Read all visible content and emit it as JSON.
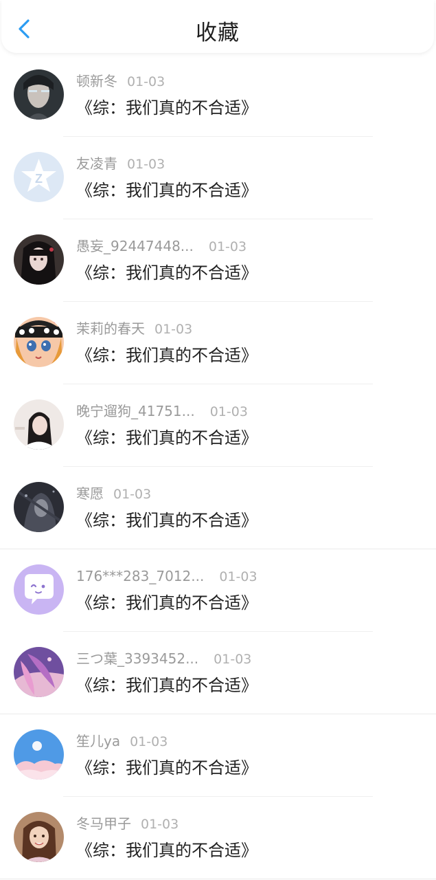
{
  "header": {
    "title": "收藏",
    "back_icon": "chevron-left-icon",
    "accent": "#2b9cf2"
  },
  "items": [
    {
      "name": "顿新冬",
      "date": "01-03",
      "title": "《综：我们真的不合适》"
    },
    {
      "name": "友凌青",
      "date": "01-03",
      "title": "《综：我们真的不合适》"
    },
    {
      "name": "愚妄_92447448...",
      "date": "01-03",
      "title": "《综：我们真的不合适》"
    },
    {
      "name": "茉莉的春天",
      "date": "01-03",
      "title": "《综：我们真的不合适》"
    },
    {
      "name": "晚宁遛狗_41751...",
      "date": "01-03",
      "title": "《综：我们真的不合适》"
    },
    {
      "name": "寒愿",
      "date": "01-03",
      "title": "《综：我们真的不合适》"
    },
    {
      "name": "176***283_7012...",
      "date": "01-03",
      "title": "《综：我们真的不合适》"
    },
    {
      "name": "三つ葉_3393452...",
      "date": "01-03",
      "title": "《综：我们真的不合适》"
    },
    {
      "name": "笙儿ya",
      "date": "01-03",
      "title": "《综：我们真的不合适》"
    },
    {
      "name": "冬马甲子",
      "date": "01-03",
      "title": "《综：我们真的不合适》"
    }
  ]
}
